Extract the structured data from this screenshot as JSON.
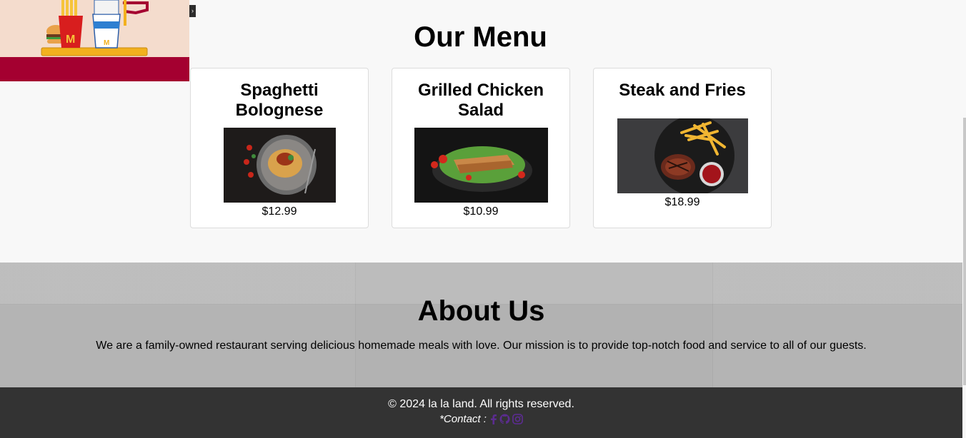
{
  "menu": {
    "title": "Our Menu",
    "items": [
      {
        "name": "Spaghetti Bolognese",
        "price": "$12.99"
      },
      {
        "name": "Grilled Chicken Salad",
        "price": "$10.99"
      },
      {
        "name": "Steak and Fries",
        "price": "$18.99"
      }
    ]
  },
  "about": {
    "title": "About Us",
    "text": "We are a family-owned restaurant serving delicious homemade meals with love. Our mission is to provide top-notch food and service to all of our guests."
  },
  "footer": {
    "copyright": "© 2024 la la land. All rights reserved.",
    "contact_label": "*Contact :"
  },
  "icons": {
    "social": [
      "facebook-icon",
      "github-icon",
      "instagram-icon"
    ],
    "social_color": "#5b2c8f"
  },
  "colors": {
    "hero_band": "#a40030",
    "footer_bg": "#333333",
    "about_bg": "#b4b4b4"
  }
}
